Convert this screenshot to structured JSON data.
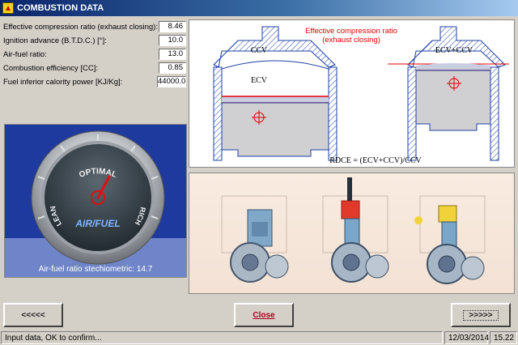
{
  "window": {
    "title": "COMBUSTION DATA"
  },
  "fields": [
    {
      "label": "Effective compression ratio (exhaust closing):",
      "value": "8.46"
    },
    {
      "label": "Ignition advance (B.T.D.C.) [°]:",
      "value": "10.0"
    },
    {
      "label": "Air-fuel ratio:",
      "value": "13.0"
    },
    {
      "label": "Combustion efficiency [CC]:",
      "value": "0.85"
    },
    {
      "label": "Fuel inferior calority power [KJ/Kg]:",
      "value": "44000.0"
    }
  ],
  "gauge": {
    "caption": "Air-fuel ratio stechiometric: 14.7",
    "top_label": "OPTIMAL",
    "left_label": "LEAN",
    "right_label": "RICH",
    "center_label": "AIR/FUEL"
  },
  "diagram": {
    "title_line1": "Effective compression ratio",
    "title_line2": "(exhaust closing)",
    "left_ccv": "CCV",
    "left_ecv": "ECV",
    "right_label": "ECV+CCV",
    "formula": "RDCE = (ECV+CCV)/CCV",
    "accent_color": "#e00000"
  },
  "buttons": {
    "prev": "<<<<<",
    "close": "Close",
    "next": ">>>>>"
  },
  "status": {
    "message": "Input data, OK to confirm...",
    "date": "12/03/2014",
    "time": "15.22"
  }
}
